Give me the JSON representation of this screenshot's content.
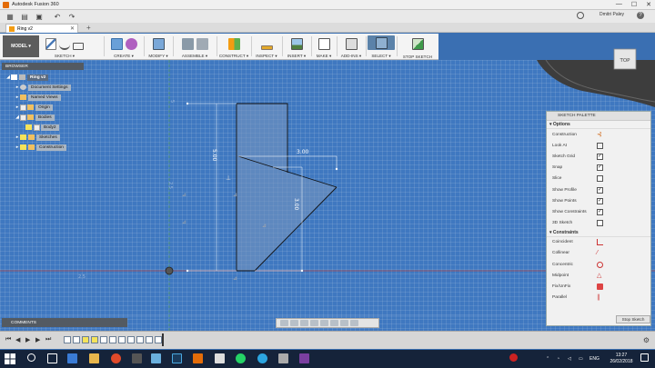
{
  "window": {
    "title": "Autodesk Fusion 360",
    "controls": [
      "—",
      "☐",
      "✕"
    ]
  },
  "qat": {
    "user": "Dmitri Paley",
    "help": "?"
  },
  "tabs": [
    {
      "label": "Ring v2"
    }
  ],
  "toolbar": {
    "mode": "MODEL ▾",
    "groups": [
      {
        "label": "SKETCH ▾"
      },
      {
        "label": "CREATE ▾"
      },
      {
        "label": "MODIFY ▾"
      },
      {
        "label": "ASSEMBLE ▾"
      },
      {
        "label": "CONSTRUCT ▾"
      },
      {
        "label": "INSPECT ▾"
      },
      {
        "label": "INSERT ▾"
      },
      {
        "label": "MAKE ▾"
      },
      {
        "label": "ADD-INS ▾"
      },
      {
        "label": "SELECT ▾"
      },
      {
        "label": "STOP SKETCH"
      }
    ]
  },
  "browser": {
    "title": "BROWSER",
    "items": [
      {
        "label": "Ring v2"
      },
      {
        "label": "Document Settings"
      },
      {
        "label": "Named Views"
      },
      {
        "label": "Origin"
      },
      {
        "label": "Bodies"
      },
      {
        "label": "Body2"
      },
      {
        "label": "Sketches"
      },
      {
        "label": "Construction"
      }
    ]
  },
  "viewcube": {
    "label": "TOP"
  },
  "sketch": {
    "dim_height": "5.00",
    "dim_top": "3.00",
    "dim_right": "3.00",
    "axis_label_1": "2.5",
    "axis_label_2": "2.5",
    "axis_label_3": "5"
  },
  "palette": {
    "title": "SKETCH PALETTE",
    "options_header": "▾ Options",
    "options": [
      {
        "label": "Construction",
        "icon": "construction-icon"
      },
      {
        "label": "Look At",
        "icon": "look-at-icon"
      },
      {
        "label": "Sketch Grid",
        "checked": "✓"
      },
      {
        "label": "Snap",
        "checked": "✓"
      },
      {
        "label": "Slice",
        "checked": ""
      },
      {
        "label": "Show Profile",
        "checked": "✓"
      },
      {
        "label": "Show Points",
        "checked": "✓"
      },
      {
        "label": "Show Constraints",
        "checked": "✓"
      },
      {
        "label": "3D Sketch",
        "checked": ""
      }
    ],
    "constraints_header": "▾ Constraints",
    "constraints": [
      {
        "label": "Coincident"
      },
      {
        "label": "Collinear"
      },
      {
        "label": "Concentric"
      },
      {
        "label": "Midpoint"
      },
      {
        "label": "Fix/UnFix"
      },
      {
        "label": "Parallel"
      }
    ],
    "stop_button": "Stop Sketch"
  },
  "comments": {
    "label": "COMMENTS"
  },
  "timeline": {
    "controls": [
      "⏮",
      "◀",
      "▶",
      "▶",
      "⏭"
    ]
  },
  "taskbar": {
    "lang": "ENG",
    "time": "13:27",
    "date": "26/02/2018"
  }
}
